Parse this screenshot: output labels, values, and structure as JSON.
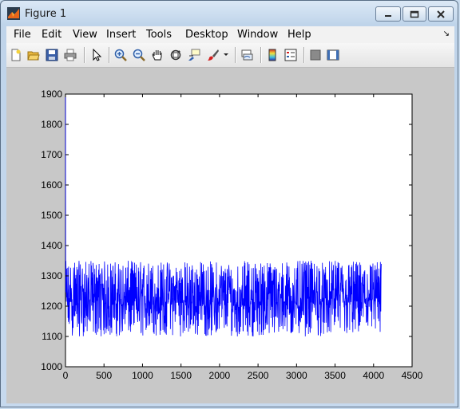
{
  "window": {
    "title": "Figure 1"
  },
  "menu": [
    "File",
    "Edit",
    "View",
    "Insert",
    "Tools",
    "Desktop",
    "Window",
    "Help"
  ],
  "toolbar_icons": [
    "new-figure-icon",
    "open-file-icon",
    "save-icon",
    "print-icon",
    "pointer-icon",
    "zoom-in-icon",
    "zoom-out-icon",
    "pan-hand-icon",
    "rotate-3d-icon",
    "data-cursor-icon",
    "brush-icon",
    "link-plot-icon",
    "colorbar-icon",
    "legend-icon",
    "hide-plot-tools-icon",
    "show-plot-tools-icon"
  ],
  "colors": {
    "line": "#0000ff",
    "figure_bg": "#c8c8c8",
    "axes_bg": "#ffffff"
  },
  "chart_data": {
    "type": "line",
    "title": "",
    "xlabel": "",
    "ylabel": "",
    "xlim": [
      0,
      4500
    ],
    "ylim": [
      1000,
      1900
    ],
    "xticks": [
      0,
      500,
      1000,
      1500,
      2000,
      2500,
      3000,
      3500,
      4000,
      4500
    ],
    "yticks": [
      1000,
      1100,
      1200,
      1300,
      1400,
      1500,
      1600,
      1700,
      1800,
      1900
    ],
    "grid": false,
    "series": [
      {
        "color": "#0000ff",
        "x_range": [
          0,
          4100
        ],
        "start_value": 1890,
        "band": [
          1090,
          1350
        ],
        "description_values": {
          "typical_min": 1100,
          "typical_max": 1340,
          "mean": 1240
        }
      }
    ]
  }
}
